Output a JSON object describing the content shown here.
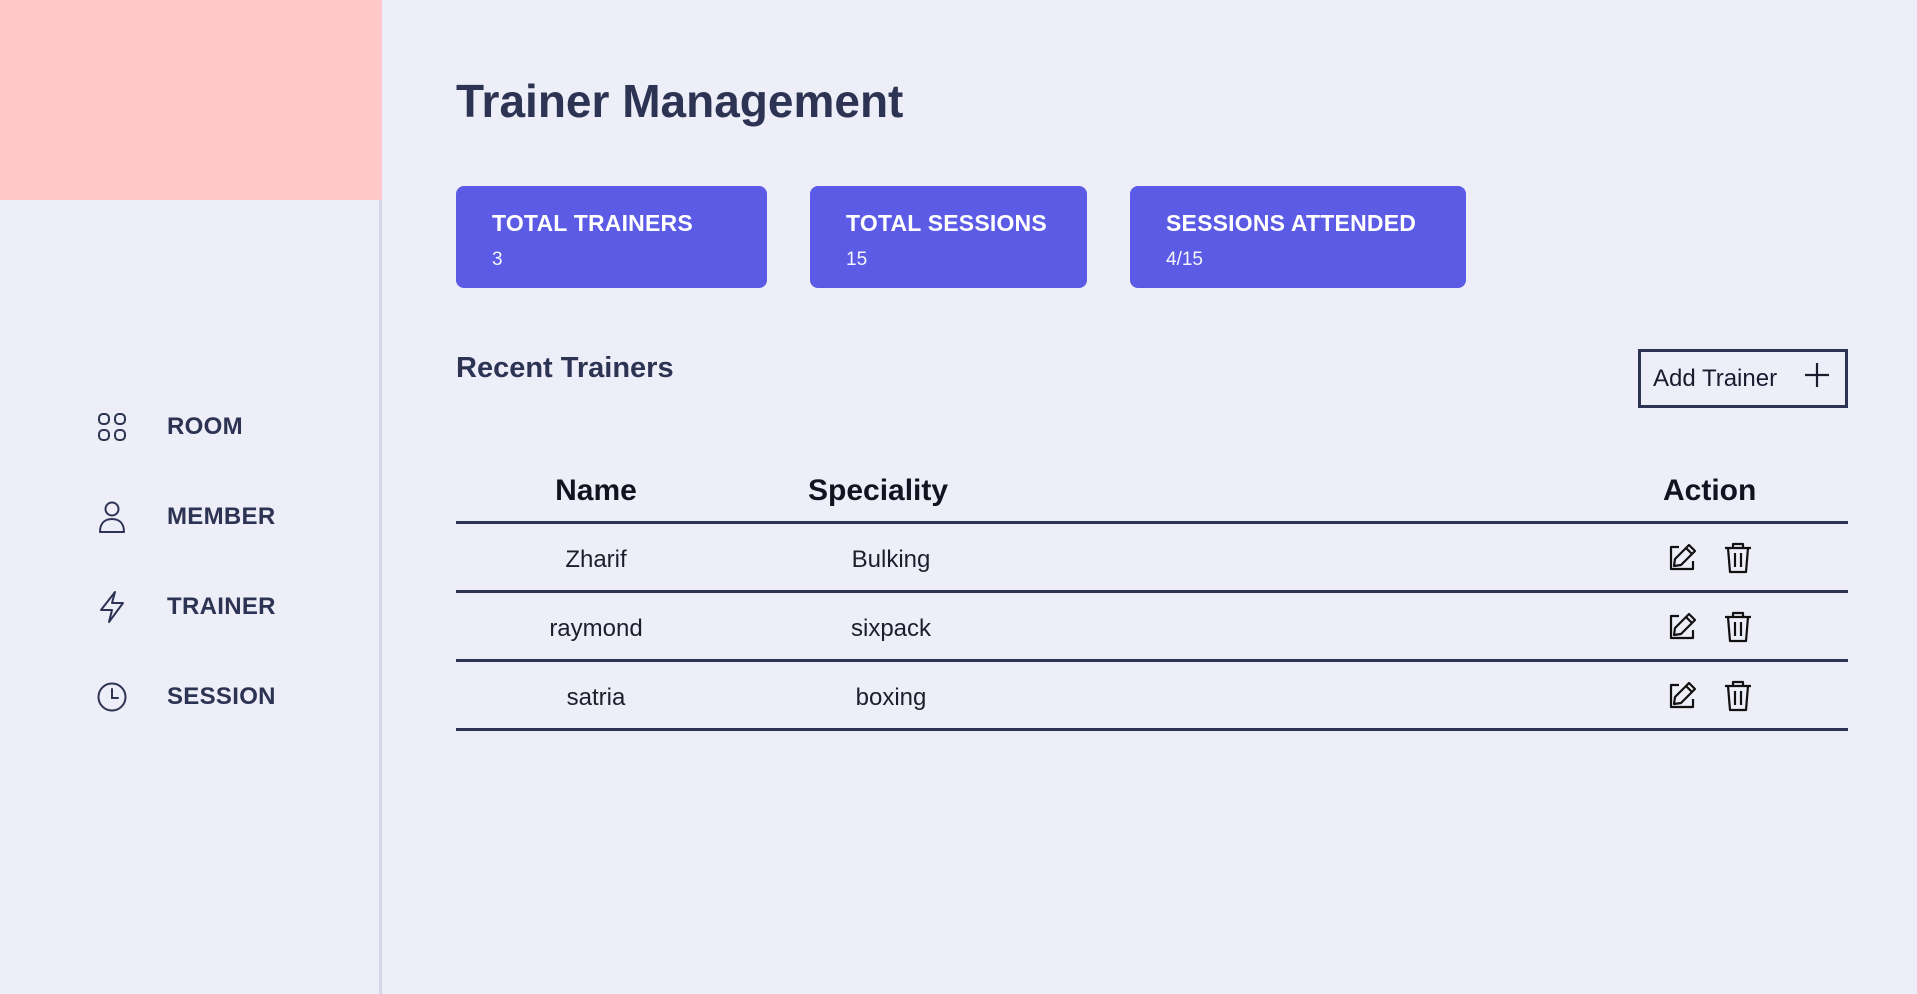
{
  "sidebar": {
    "items": [
      {
        "label": "ROOM",
        "icon": "grid-icon"
      },
      {
        "label": "MEMBER",
        "icon": "user-icon"
      },
      {
        "label": "TRAINER",
        "icon": "lightning-icon"
      },
      {
        "label": "SESSION",
        "icon": "clock-icon"
      }
    ]
  },
  "page": {
    "title": "Trainer Management"
  },
  "stats": [
    {
      "label": "TOTAL TRAINERS",
      "value": "3"
    },
    {
      "label": "TOTAL SESSIONS",
      "value": "15"
    },
    {
      "label": "SESSIONS ATTENDED",
      "value": "4/15"
    }
  ],
  "section": {
    "title": "Recent Trainers",
    "add_button": "Add Trainer"
  },
  "table": {
    "headers": [
      "Name",
      "Speciality",
      "Action"
    ],
    "rows": [
      {
        "name": "Zharif",
        "speciality": "Bulking"
      },
      {
        "name": "raymond",
        "speciality": "sixpack"
      },
      {
        "name": "satria",
        "speciality": "boxing"
      }
    ]
  },
  "colors": {
    "accent": "#5b5be6",
    "logo_bg": "#fec9c8",
    "text": "#2d3353",
    "background": "#edeef8"
  }
}
